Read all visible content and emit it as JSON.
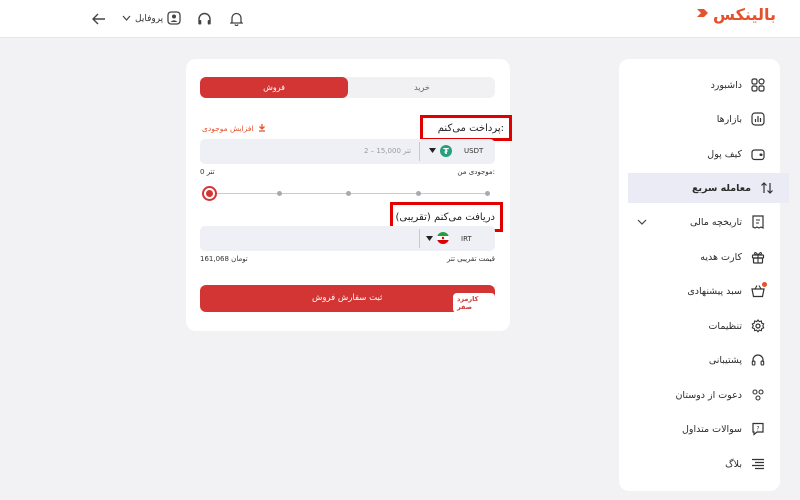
{
  "header": {
    "logo_text": "بالینکس",
    "profile_label": "پروفایل"
  },
  "sidebar": {
    "items": [
      {
        "label": "داشبورد",
        "icon": "grid-icon"
      },
      {
        "label": "بازارها",
        "icon": "chart-icon"
      },
      {
        "label": "کیف پول",
        "icon": "wallet-icon"
      },
      {
        "label": "معامله سریع",
        "icon": "swap-arrows-icon",
        "active": true
      },
      {
        "label": "تاریخچه مالی",
        "icon": "receipt-icon",
        "expandable": true
      },
      {
        "label": "کارت هدیه",
        "icon": "gift-icon"
      },
      {
        "label": "سبد پیشنهادی",
        "icon": "basket-icon",
        "badge": true
      },
      {
        "label": "تنظیمات",
        "icon": "gear-icon"
      },
      {
        "label": "پشتیبانی",
        "icon": "headset-icon"
      },
      {
        "label": "دعوت از دوستان",
        "icon": "users-icon"
      },
      {
        "label": "سوالات متداول",
        "icon": "faq-icon"
      },
      {
        "label": "بلاگ",
        "icon": "blog-icon"
      }
    ]
  },
  "trade": {
    "tab_buy": "خرید",
    "tab_sell": "فروش",
    "active_tab": "sell",
    "pay_label": "پرداخت می‌کنم:",
    "boost_label": "افزایش موجودی",
    "pay_placeholder": "2 – 15,000 تتر",
    "pay_currency": "USDT",
    "balance_label": "موجودی من:",
    "balance_value": "0 تتر",
    "slider_value": 0,
    "receive_label": "دریافت می‌کنم (تقریبی)",
    "receive_currency": "IRT",
    "price_label": "قیمت تقریبی تتر",
    "price_value": "161,068 تومان",
    "submit_label": "ثبت سفارش فروش",
    "fee_badge": "کارمزد صفر"
  },
  "colors": {
    "brand": "#e5512b",
    "primary_red": "#d33535",
    "tether_green": "#26a17b",
    "active_bg": "#ebebf5"
  }
}
